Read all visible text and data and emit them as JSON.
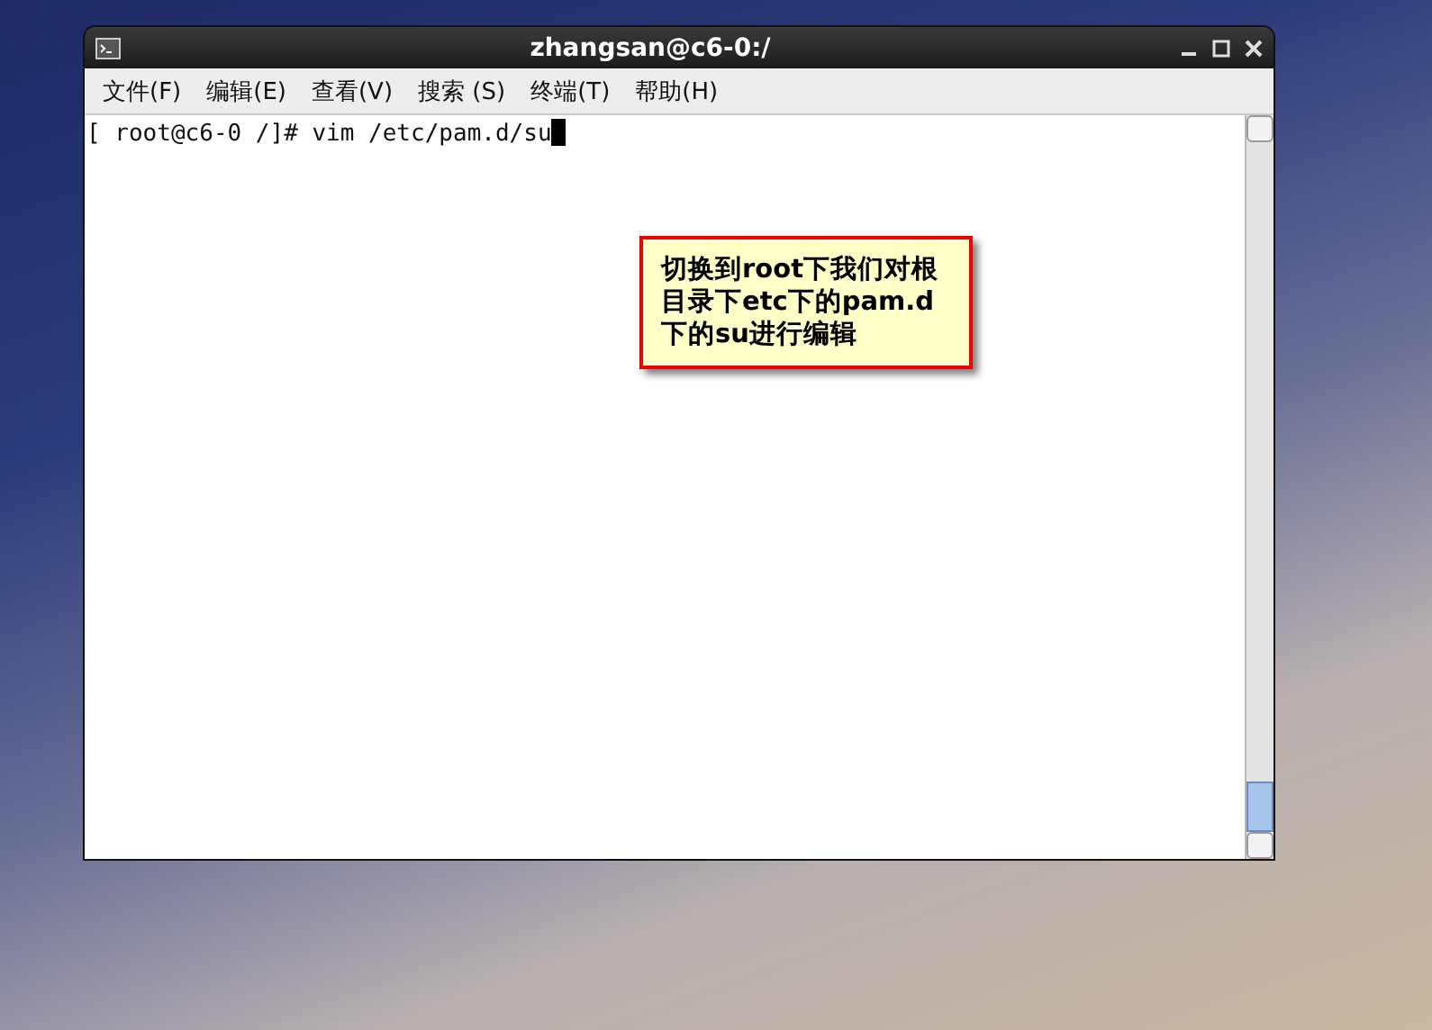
{
  "window": {
    "title": "zhangsan@c6-0:/"
  },
  "menu": [
    {
      "label": "文件(F)"
    },
    {
      "label": "编辑(E)"
    },
    {
      "label": "查看(V)"
    },
    {
      "label": "搜索 (S)"
    },
    {
      "label": "终端(T)"
    },
    {
      "label": "帮助(H)"
    }
  ],
  "terminal": {
    "lines": [
      "[ root@c6-0 /]# vim /etc/pam.d/su"
    ]
  },
  "callout": {
    "text": "切换到root下我们对根目录下etc下的pam.d下的su进行编辑"
  }
}
